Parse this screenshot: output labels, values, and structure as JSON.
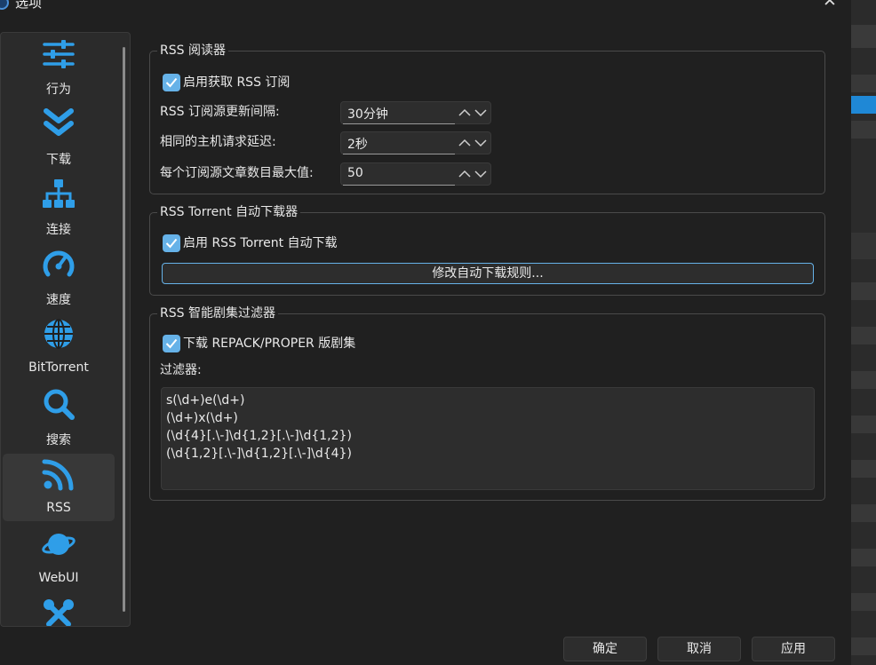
{
  "window": {
    "title": "选项",
    "close_symbol": "✕"
  },
  "sidebar": {
    "items": [
      {
        "label": "行为",
        "icon": "sliders-icon",
        "selected": false
      },
      {
        "label": "下载",
        "icon": "double-chevron-down-icon",
        "selected": false
      },
      {
        "label": "连接",
        "icon": "network-icon",
        "selected": false
      },
      {
        "label": "速度",
        "icon": "speedometer-icon",
        "selected": false
      },
      {
        "label": "BitTorrent",
        "icon": "globe-icon",
        "selected": false
      },
      {
        "label": "搜索",
        "icon": "search-icon",
        "selected": false
      },
      {
        "label": "RSS",
        "icon": "rss-icon",
        "selected": true
      },
      {
        "label": "WebUI",
        "icon": "planet-icon",
        "selected": false
      },
      {
        "label": "",
        "icon": "tools-icon",
        "selected": false
      }
    ]
  },
  "rss_reader": {
    "title": "RSS 阅读器",
    "enable_label": "启用获取 RSS 订阅",
    "enable_checked": true,
    "refresh_label": "RSS 订阅源更新间隔:",
    "refresh_value": "30分钟",
    "delay_label": "相同的主机请求延迟:",
    "delay_value": "2秒",
    "max_articles_label": "每个订阅源文章数目最大值:",
    "max_articles_value": "50"
  },
  "auto_downloader": {
    "title": "RSS Torrent 自动下载器",
    "enable_label": "启用 RSS Torrent 自动下载",
    "enable_checked": true,
    "rules_button": "修改自动下载规则..."
  },
  "smart_filter": {
    "title": "RSS 智能剧集过滤器",
    "repack_label": "下载 REPACK/PROPER 版剧集",
    "repack_checked": true,
    "filters_label": "过滤器:",
    "filters": [
      "s(\\d+)e(\\d+)",
      "(\\d+)x(\\d+)",
      "(\\d{4}[.\\-]\\d{1,2}[.\\-]\\d{1,2})",
      "(\\d{1,2}[.\\-]\\d{1,2}[.\\-]\\d{4})"
    ]
  },
  "buttons": {
    "ok": "确定",
    "cancel": "取消",
    "apply": "应用"
  },
  "colors": {
    "accent": "#66b2e8",
    "icon_blue": "#2f9ee8",
    "background": "#202020",
    "panel": "#2b2b2b"
  }
}
